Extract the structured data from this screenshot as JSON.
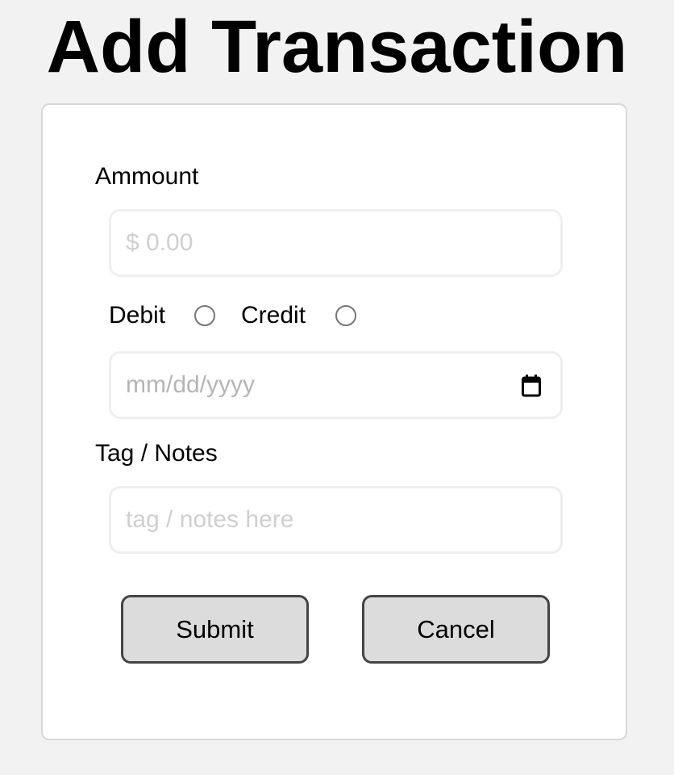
{
  "page": {
    "title": "Add Transaction"
  },
  "form": {
    "amount": {
      "label": "Ammount",
      "placeholder": "$ 0.00",
      "value": ""
    },
    "type": {
      "debit_label": "Debit",
      "credit_label": "Credit",
      "selected": null
    },
    "date": {
      "placeholder": "mm/dd/yyyy",
      "icon": "calendar-icon"
    },
    "notes": {
      "label": "Tag / Notes",
      "placeholder": "tag / notes here",
      "value": ""
    },
    "buttons": {
      "submit_label": "Submit",
      "cancel_label": "Cancel"
    }
  },
  "colors": {
    "page_background": "#f2f2f2",
    "card_background": "#ffffff",
    "button_background": "#dcdcdc",
    "button_border": "#444444",
    "placeholder_text": "#cfcfcf"
  }
}
